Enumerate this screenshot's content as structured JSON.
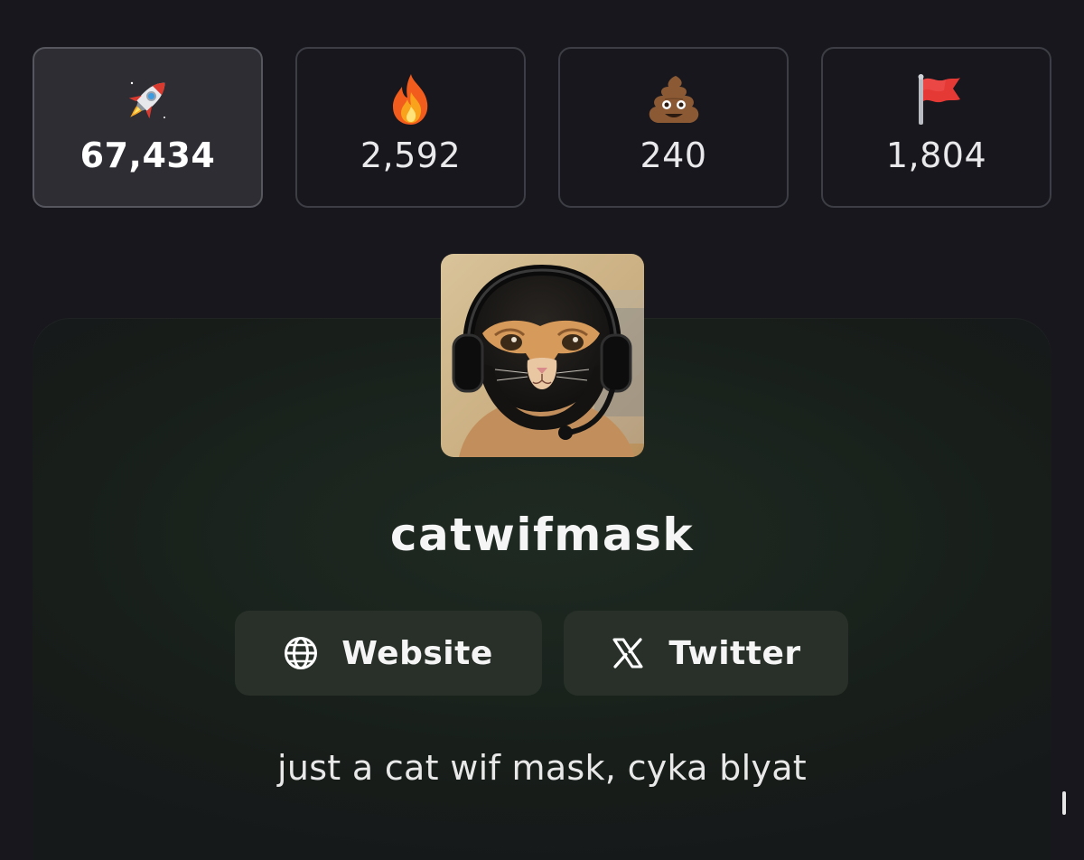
{
  "reactions": [
    {
      "icon": "rocket-icon",
      "count": "67,434",
      "active": true
    },
    {
      "icon": "fire-icon",
      "count": "2,592",
      "active": false
    },
    {
      "icon": "poop-icon",
      "count": "240",
      "active": false
    },
    {
      "icon": "red-flag-icon",
      "count": "1,804",
      "active": false
    }
  ],
  "token": {
    "avatar_icon": "cat-wearing-balaclava-and-headset",
    "name": "catwifmask",
    "description": "just a cat wif mask, cyka blyat"
  },
  "links": {
    "website_label": "Website",
    "website_icon": "globe-icon",
    "twitter_label": "Twitter",
    "twitter_icon": "x-logo-icon"
  },
  "colors": {
    "background": "#17171d",
    "card_border": "#3d3d45",
    "active_card_bg": "#2d2d33",
    "panel_green": "#1f2a22",
    "button_bg": "#283029"
  }
}
